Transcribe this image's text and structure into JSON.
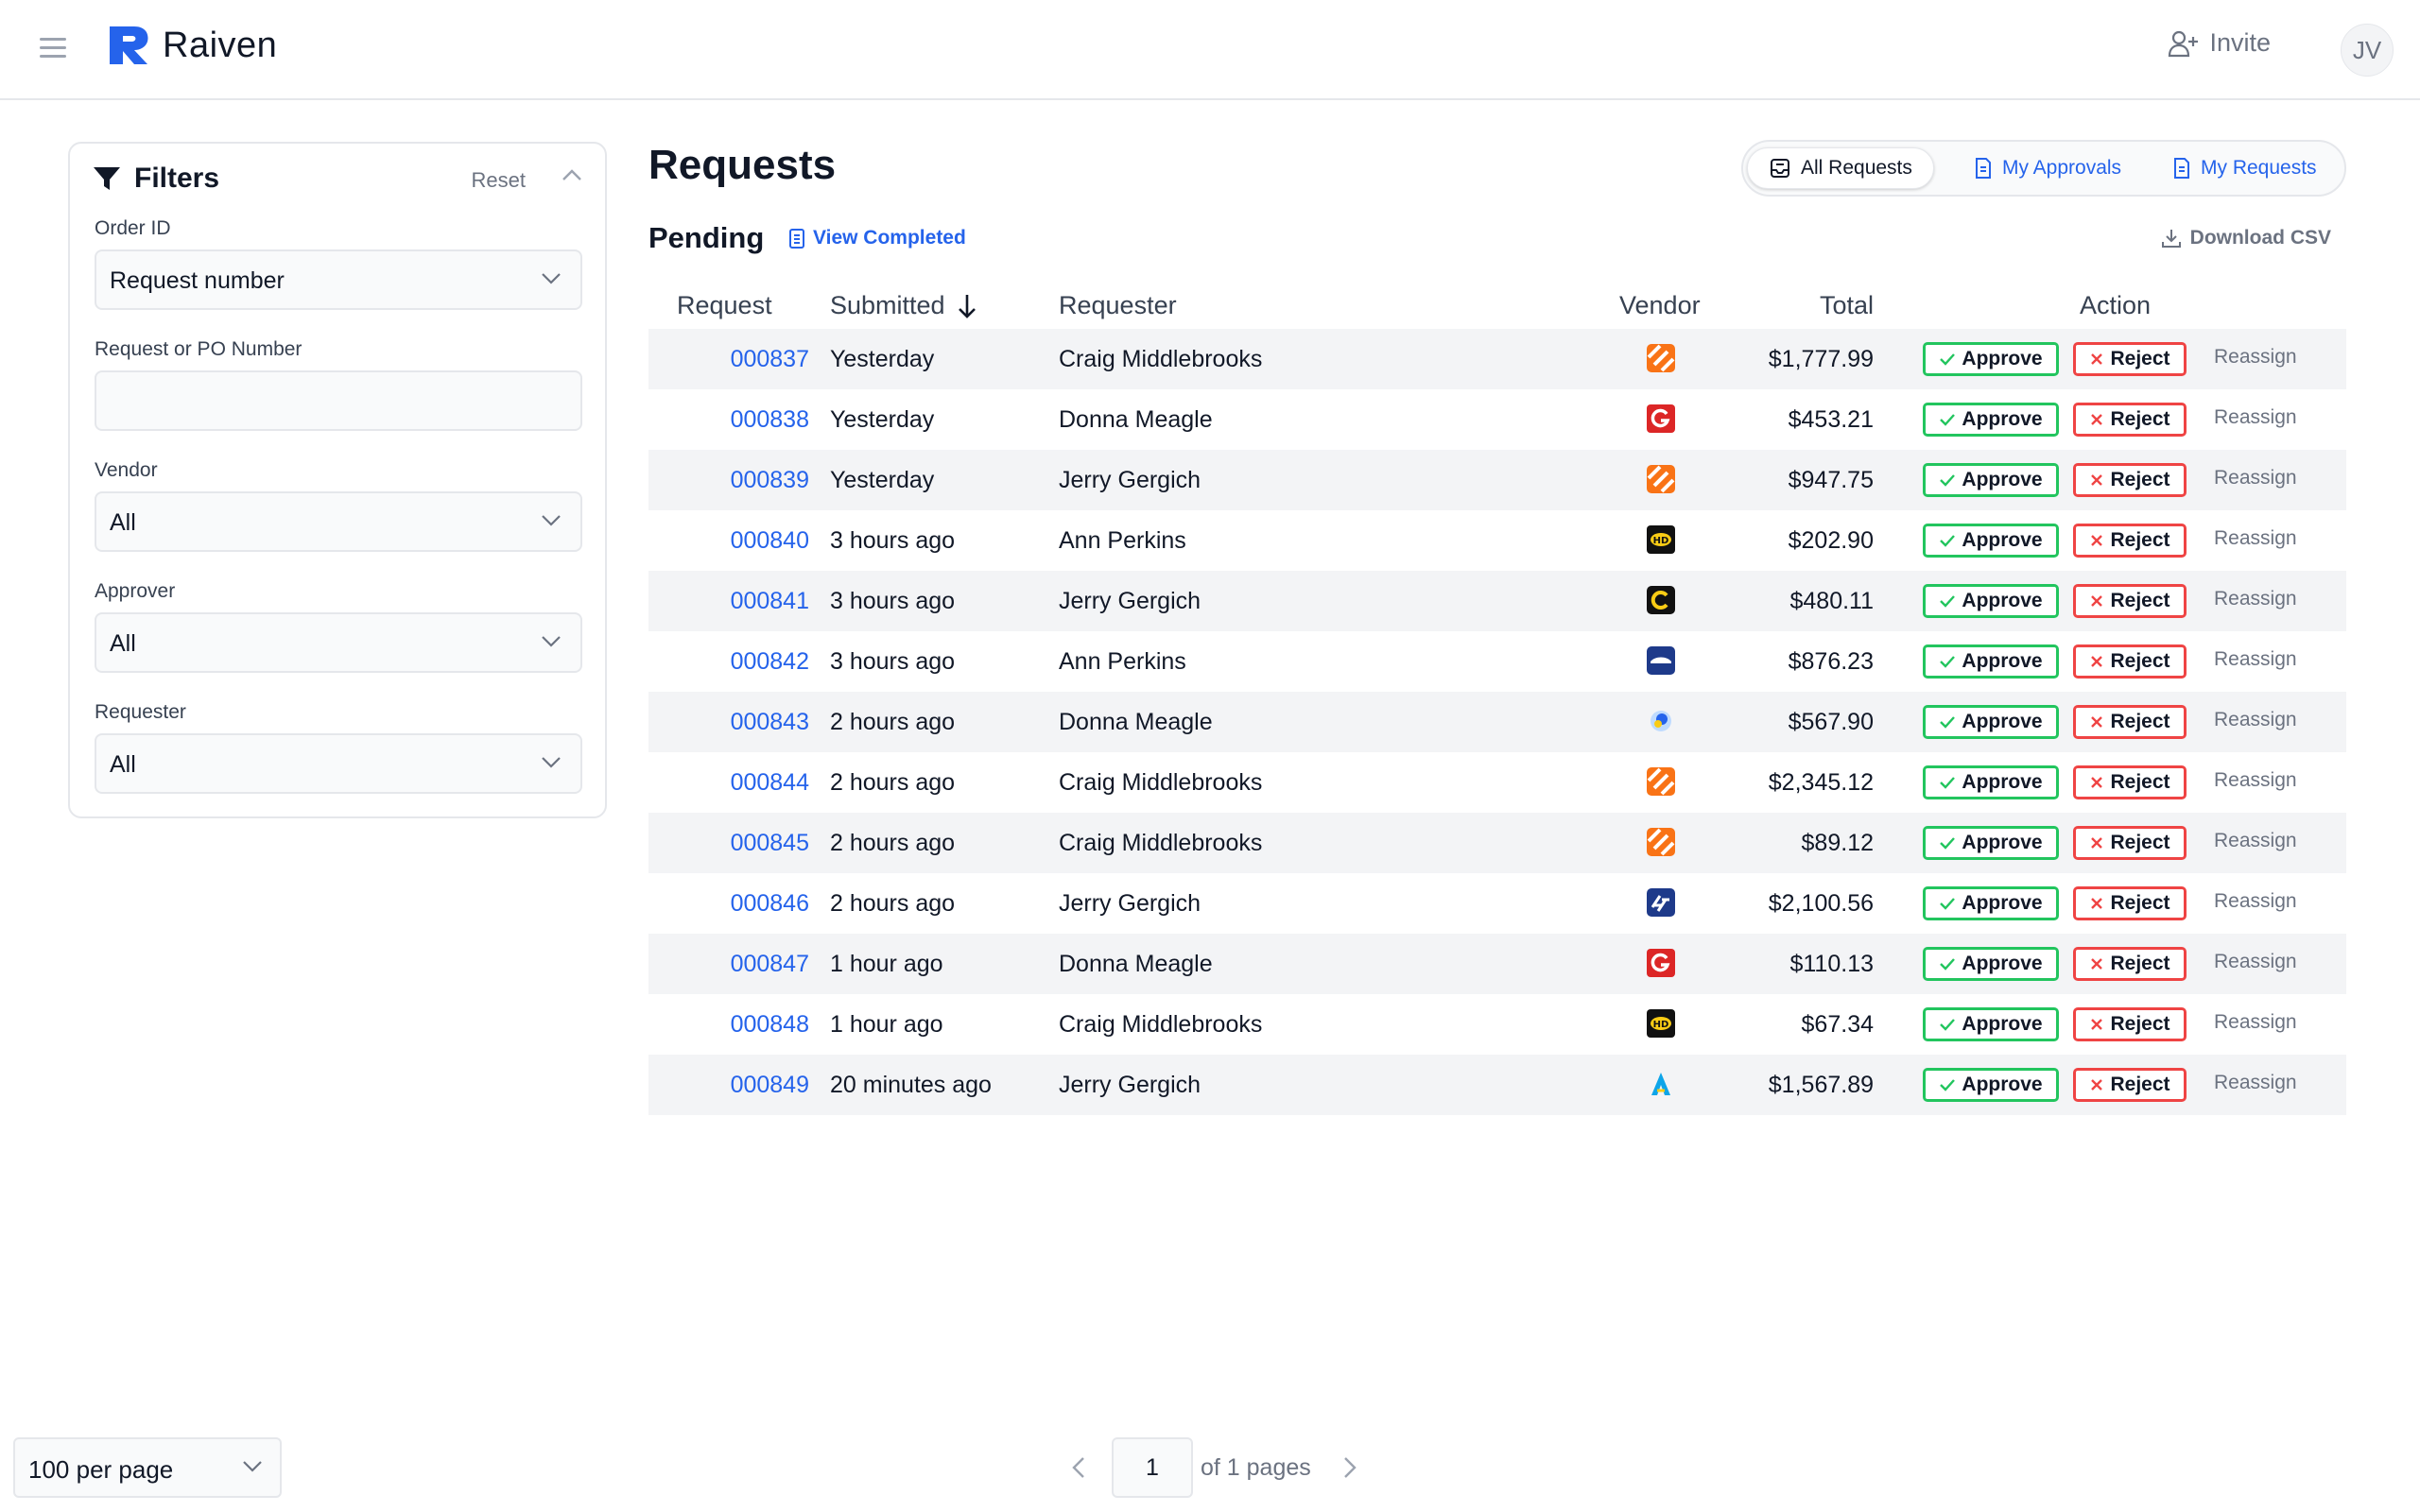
{
  "app": {
    "name": "Raiven",
    "invite_label": "Invite",
    "user_initials": "JV"
  },
  "filters": {
    "title": "Filters",
    "reset_label": "Reset",
    "order_id": {
      "label": "Order ID",
      "value": "Request number"
    },
    "request_po": {
      "label": "Request or PO Number",
      "value": ""
    },
    "vendor": {
      "label": "Vendor",
      "value": "All"
    },
    "approver": {
      "label": "Approver",
      "value": "All"
    },
    "requester": {
      "label": "Requester",
      "value": "All"
    }
  },
  "main": {
    "title": "Requests",
    "tabs": [
      {
        "label": "All Requests",
        "active": true,
        "icon": "inbox-icon"
      },
      {
        "label": "My Approvals",
        "active": false,
        "icon": "document-icon"
      },
      {
        "label": "My Requests",
        "active": false,
        "icon": "document-icon"
      }
    ],
    "section_title": "Pending",
    "view_completed_label": "View Completed",
    "download_label": "Download CSV"
  },
  "table": {
    "headers": {
      "request": "Request",
      "submitted": "Submitted",
      "requester": "Requester",
      "vendor": "Vendor",
      "total": "Total",
      "action": "Action"
    },
    "sort_icon": "arrow-down-icon",
    "action_labels": {
      "approve": "Approve",
      "reject": "Reject",
      "reassign": "Reassign"
    },
    "rows": [
      {
        "id": "000837",
        "submitted": "Yesterday",
        "requester": "Craig Middlebrooks",
        "vendor_icon": "orange-stripes-logo",
        "total": "$1,777.99"
      },
      {
        "id": "000838",
        "submitted": "Yesterday",
        "requester": "Donna Meagle",
        "vendor_icon": "red-g-logo",
        "total": "$453.21"
      },
      {
        "id": "000839",
        "submitted": "Yesterday",
        "requester": "Jerry Gergich",
        "vendor_icon": "orange-stripes-logo",
        "total": "$947.75"
      },
      {
        "id": "000840",
        "submitted": "3 hours ago",
        "requester": "Ann Perkins",
        "vendor_icon": "black-hd-logo",
        "total": "$202.90"
      },
      {
        "id": "000841",
        "submitted": "3 hours ago",
        "requester": "Jerry Gergich",
        "vendor_icon": "black-c-logo",
        "total": "$480.11"
      },
      {
        "id": "000842",
        "submitted": "3 hours ago",
        "requester": "Ann Perkins",
        "vendor_icon": "blue-wave-logo",
        "total": "$876.23"
      },
      {
        "id": "000843",
        "submitted": "2 hours ago",
        "requester": "Donna Meagle",
        "vendor_icon": "blue-swirl-logo",
        "total": "$567.90"
      },
      {
        "id": "000844",
        "submitted": "2 hours ago",
        "requester": "Craig Middlebrooks",
        "vendor_icon": "orange-stripes-logo",
        "total": "$2,345.12"
      },
      {
        "id": "000845",
        "submitted": "2 hours ago",
        "requester": "Craig Middlebrooks",
        "vendor_icon": "orange-stripes-logo",
        "total": "$89.12"
      },
      {
        "id": "000846",
        "submitted": "2 hours ago",
        "requester": "Jerry Gergich",
        "vendor_icon": "navy-pattern-logo",
        "total": "$2,100.56"
      },
      {
        "id": "000847",
        "submitted": "1 hour ago",
        "requester": "Donna Meagle",
        "vendor_icon": "red-g-logo",
        "total": "$110.13"
      },
      {
        "id": "000848",
        "submitted": "1 hour ago",
        "requester": "Craig Middlebrooks",
        "vendor_icon": "black-hd-logo",
        "total": "$67.34"
      },
      {
        "id": "000849",
        "submitted": "20 minutes ago",
        "requester": "Jerry Gergich",
        "vendor_icon": "blue-a-logo",
        "total": "$1,567.89"
      }
    ]
  },
  "pagination": {
    "per_page": "100 per page",
    "page": "1",
    "of_pages": "of 1 pages"
  },
  "colors": {
    "brand": "#2563eb",
    "approve": "#22c55e",
    "reject": "#ef4444",
    "row_stripe": "#f3f4f6"
  }
}
